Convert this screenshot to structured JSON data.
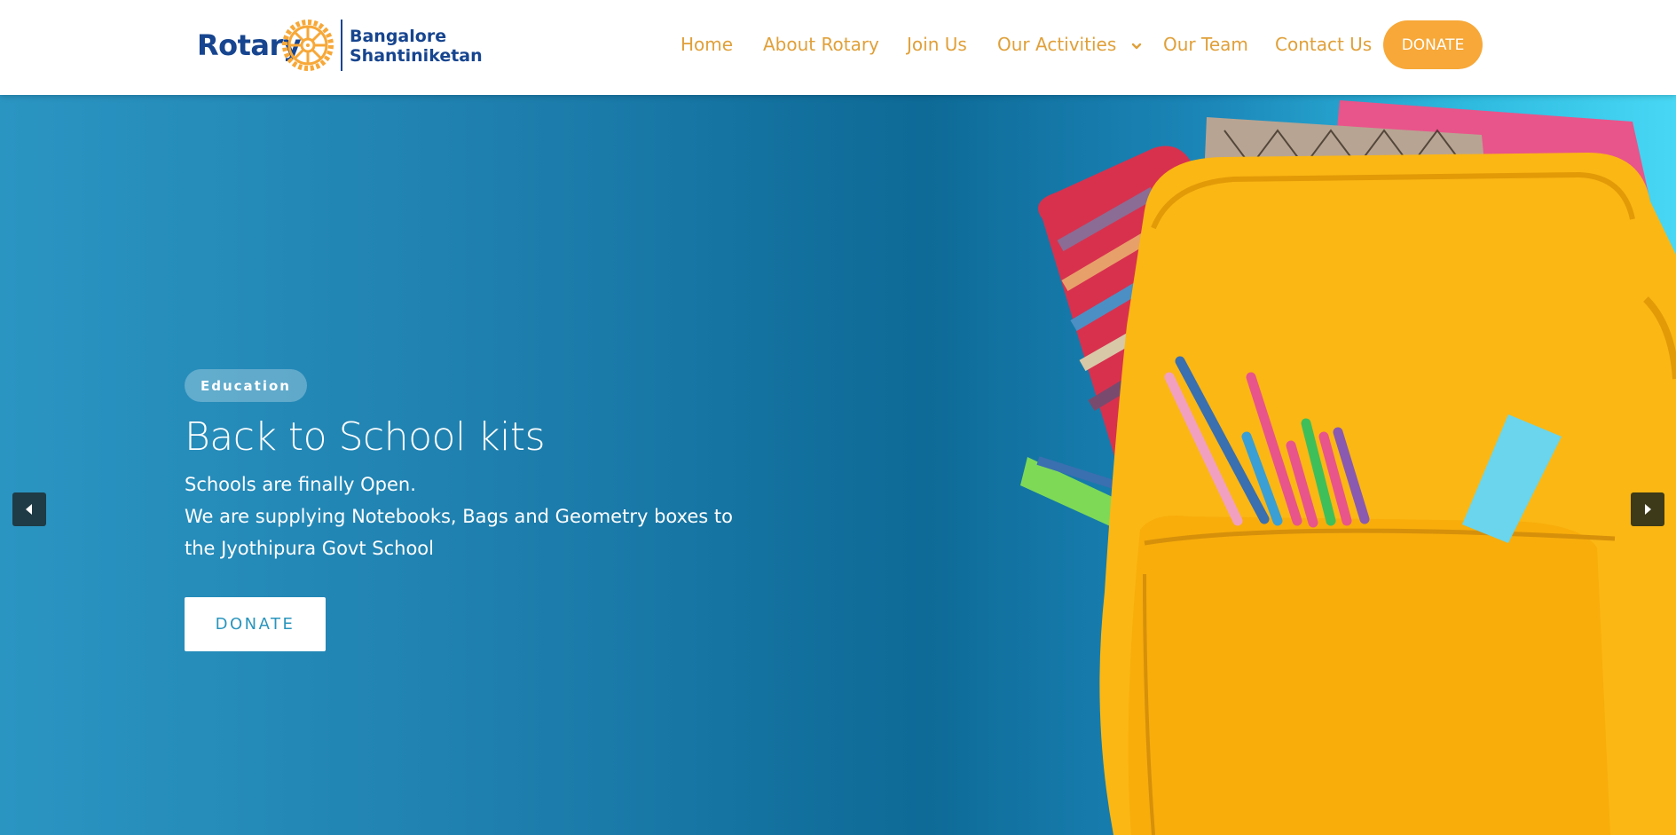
{
  "header": {
    "logo": {
      "word": "Rotary",
      "line1": "Bangalore",
      "line2": "Shantiniketan"
    },
    "nav": [
      {
        "label": "Home"
      },
      {
        "label": "About Rotary"
      },
      {
        "label": "Join Us"
      },
      {
        "label": "Our Activities",
        "icon": "chevron-down-icon"
      },
      {
        "label": "Our Team"
      },
      {
        "label": "Contact Us"
      }
    ],
    "donate_label": "DONATE"
  },
  "hero": {
    "tag": "Education",
    "title": "Back to School kits",
    "desc_line1": "Schools are finally Open.",
    "desc_line2": "We are supplying Notebooks, Bags and Geometry boxes to the Jyothipura Govt School",
    "button_label": "DONATE",
    "prev_icon": "arrow-left-icon",
    "next_icon": "arrow-right-icon"
  },
  "colors": {
    "brand_blue": "#17458f",
    "brand_gold": "#f7a838",
    "nav_text": "#e0a039",
    "hero_blue": "#1e7fae",
    "bag_yellow": "#fbb714"
  }
}
